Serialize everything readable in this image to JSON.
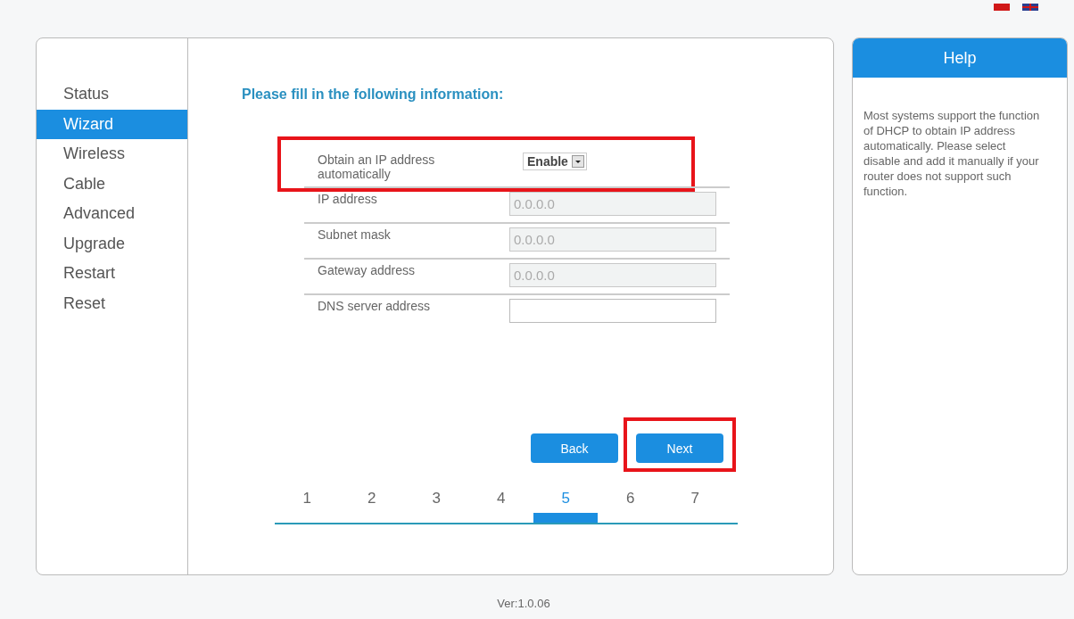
{
  "sidebar": {
    "items": [
      {
        "label": "Status",
        "selected": false
      },
      {
        "label": "Wizard",
        "selected": true
      },
      {
        "label": "Wireless",
        "selected": false
      },
      {
        "label": "Cable",
        "selected": false
      },
      {
        "label": "Advanced",
        "selected": false
      },
      {
        "label": "Upgrade",
        "selected": false
      },
      {
        "label": "Restart",
        "selected": false
      },
      {
        "label": "Reset",
        "selected": false
      }
    ]
  },
  "heading": "Please fill in the following information:",
  "fields": [
    {
      "kind": "select",
      "label": "Obtain an IP address automatically",
      "value": "Enable",
      "highlighted": true
    },
    {
      "kind": "text",
      "label": "IP address",
      "value": "0.0.0.0",
      "disabled": true,
      "highlighted": false
    },
    {
      "kind": "text",
      "label": "Subnet mask",
      "value": "0.0.0.0",
      "disabled": true,
      "highlighted": false
    },
    {
      "kind": "text",
      "label": "Gateway address",
      "value": "0.0.0.0",
      "disabled": true,
      "highlighted": false
    },
    {
      "kind": "text",
      "label": "DNS server address",
      "disabled": false,
      "highlighted": false
    }
  ],
  "buttons": [
    {
      "label": "Back",
      "highlighted": false
    },
    {
      "label": "Next",
      "highlighted": true
    }
  ],
  "steps": [
    {
      "label": "1",
      "selected": false
    },
    {
      "label": "2",
      "selected": false
    },
    {
      "label": "3",
      "selected": false
    },
    {
      "label": "4",
      "selected": false
    },
    {
      "label": "5",
      "selected": true
    },
    {
      "label": "6",
      "selected": false
    },
    {
      "label": "7",
      "selected": false
    }
  ],
  "help": {
    "title": "Help",
    "text": "Most systems support the function of DHCP to obtain IP address automatically. Please select disable and add it manually if your router does not support such function."
  },
  "version": "Ver:1.0.06"
}
